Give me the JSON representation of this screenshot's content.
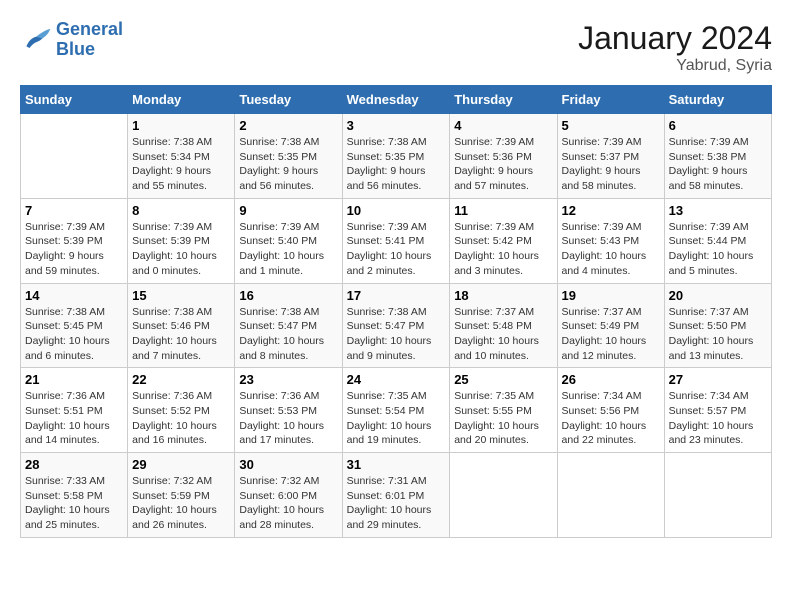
{
  "header": {
    "logo_line1": "General",
    "logo_line2": "Blue",
    "month_year": "January 2024",
    "location": "Yabrud, Syria"
  },
  "columns": [
    "Sunday",
    "Monday",
    "Tuesday",
    "Wednesday",
    "Thursday",
    "Friday",
    "Saturday"
  ],
  "weeks": [
    [
      {
        "day": "",
        "info": ""
      },
      {
        "day": "1",
        "info": "Sunrise: 7:38 AM\nSunset: 5:34 PM\nDaylight: 9 hours\nand 55 minutes."
      },
      {
        "day": "2",
        "info": "Sunrise: 7:38 AM\nSunset: 5:35 PM\nDaylight: 9 hours\nand 56 minutes."
      },
      {
        "day": "3",
        "info": "Sunrise: 7:38 AM\nSunset: 5:35 PM\nDaylight: 9 hours\nand 56 minutes."
      },
      {
        "day": "4",
        "info": "Sunrise: 7:39 AM\nSunset: 5:36 PM\nDaylight: 9 hours\nand 57 minutes."
      },
      {
        "day": "5",
        "info": "Sunrise: 7:39 AM\nSunset: 5:37 PM\nDaylight: 9 hours\nand 58 minutes."
      },
      {
        "day": "6",
        "info": "Sunrise: 7:39 AM\nSunset: 5:38 PM\nDaylight: 9 hours\nand 58 minutes."
      }
    ],
    [
      {
        "day": "7",
        "info": "Sunrise: 7:39 AM\nSunset: 5:39 PM\nDaylight: 9 hours\nand 59 minutes."
      },
      {
        "day": "8",
        "info": "Sunrise: 7:39 AM\nSunset: 5:39 PM\nDaylight: 10 hours\nand 0 minutes."
      },
      {
        "day": "9",
        "info": "Sunrise: 7:39 AM\nSunset: 5:40 PM\nDaylight: 10 hours\nand 1 minute."
      },
      {
        "day": "10",
        "info": "Sunrise: 7:39 AM\nSunset: 5:41 PM\nDaylight: 10 hours\nand 2 minutes."
      },
      {
        "day": "11",
        "info": "Sunrise: 7:39 AM\nSunset: 5:42 PM\nDaylight: 10 hours\nand 3 minutes."
      },
      {
        "day": "12",
        "info": "Sunrise: 7:39 AM\nSunset: 5:43 PM\nDaylight: 10 hours\nand 4 minutes."
      },
      {
        "day": "13",
        "info": "Sunrise: 7:39 AM\nSunset: 5:44 PM\nDaylight: 10 hours\nand 5 minutes."
      }
    ],
    [
      {
        "day": "14",
        "info": "Sunrise: 7:38 AM\nSunset: 5:45 PM\nDaylight: 10 hours\nand 6 minutes."
      },
      {
        "day": "15",
        "info": "Sunrise: 7:38 AM\nSunset: 5:46 PM\nDaylight: 10 hours\nand 7 minutes."
      },
      {
        "day": "16",
        "info": "Sunrise: 7:38 AM\nSunset: 5:47 PM\nDaylight: 10 hours\nand 8 minutes."
      },
      {
        "day": "17",
        "info": "Sunrise: 7:38 AM\nSunset: 5:47 PM\nDaylight: 10 hours\nand 9 minutes."
      },
      {
        "day": "18",
        "info": "Sunrise: 7:37 AM\nSunset: 5:48 PM\nDaylight: 10 hours\nand 10 minutes."
      },
      {
        "day": "19",
        "info": "Sunrise: 7:37 AM\nSunset: 5:49 PM\nDaylight: 10 hours\nand 12 minutes."
      },
      {
        "day": "20",
        "info": "Sunrise: 7:37 AM\nSunset: 5:50 PM\nDaylight: 10 hours\nand 13 minutes."
      }
    ],
    [
      {
        "day": "21",
        "info": "Sunrise: 7:36 AM\nSunset: 5:51 PM\nDaylight: 10 hours\nand 14 minutes."
      },
      {
        "day": "22",
        "info": "Sunrise: 7:36 AM\nSunset: 5:52 PM\nDaylight: 10 hours\nand 16 minutes."
      },
      {
        "day": "23",
        "info": "Sunrise: 7:36 AM\nSunset: 5:53 PM\nDaylight: 10 hours\nand 17 minutes."
      },
      {
        "day": "24",
        "info": "Sunrise: 7:35 AM\nSunset: 5:54 PM\nDaylight: 10 hours\nand 19 minutes."
      },
      {
        "day": "25",
        "info": "Sunrise: 7:35 AM\nSunset: 5:55 PM\nDaylight: 10 hours\nand 20 minutes."
      },
      {
        "day": "26",
        "info": "Sunrise: 7:34 AM\nSunset: 5:56 PM\nDaylight: 10 hours\nand 22 minutes."
      },
      {
        "day": "27",
        "info": "Sunrise: 7:34 AM\nSunset: 5:57 PM\nDaylight: 10 hours\nand 23 minutes."
      }
    ],
    [
      {
        "day": "28",
        "info": "Sunrise: 7:33 AM\nSunset: 5:58 PM\nDaylight: 10 hours\nand 25 minutes."
      },
      {
        "day": "29",
        "info": "Sunrise: 7:32 AM\nSunset: 5:59 PM\nDaylight: 10 hours\nand 26 minutes."
      },
      {
        "day": "30",
        "info": "Sunrise: 7:32 AM\nSunset: 6:00 PM\nDaylight: 10 hours\nand 28 minutes."
      },
      {
        "day": "31",
        "info": "Sunrise: 7:31 AM\nSunset: 6:01 PM\nDaylight: 10 hours\nand 29 minutes."
      },
      {
        "day": "",
        "info": ""
      },
      {
        "day": "",
        "info": ""
      },
      {
        "day": "",
        "info": ""
      }
    ]
  ]
}
